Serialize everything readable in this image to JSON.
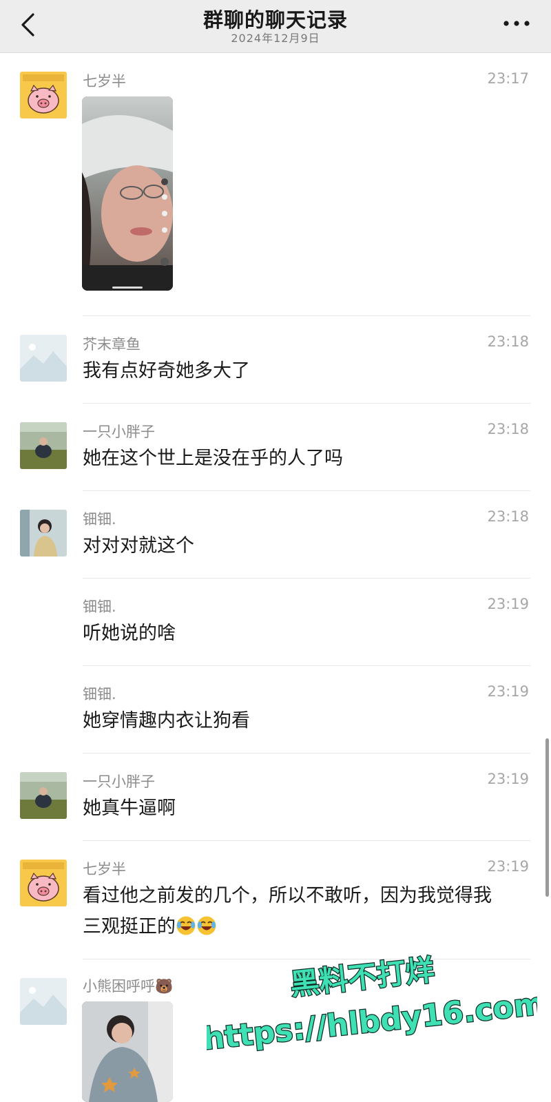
{
  "header": {
    "title": "群聊的聊天记录",
    "date": "2024年12月9日"
  },
  "messages": [
    {
      "sender": "七岁半",
      "time": "23:17",
      "avatar": "pig-avatar",
      "type": "image"
    },
    {
      "sender": "芥末章鱼",
      "time": "23:18",
      "avatar": "placeholder-avatar",
      "text": "我有点好奇她多大了"
    },
    {
      "sender": "一只小胖子",
      "time": "23:18",
      "avatar": "photo-avatar",
      "text": "她在这个世上是没在乎的人了吗"
    },
    {
      "sender": "钿钿.",
      "time": "23:18",
      "avatar": "girl-avatar",
      "text": "对对对就这个"
    },
    {
      "sender": "钿钿.",
      "time": "23:19",
      "text": "听她说的啥"
    },
    {
      "sender": "钿钿.",
      "time": "23:19",
      "text": "她穿情趣内衣让狗看"
    },
    {
      "sender": "一只小胖子",
      "time": "23:19",
      "avatar": "photo-avatar",
      "text": "她真牛逼啊"
    },
    {
      "sender": "七岁半",
      "time": "23:19",
      "avatar": "pig-avatar",
      "text_line1": "看过他之前发的几个，所以不敢听，因为我觉得我",
      "text_line2": "三观挺正的"
    },
    {
      "sender": "小熊困呼呼🐻",
      "avatar": "placeholder-avatar",
      "type": "image"
    }
  ],
  "watermark": {
    "line1": "黑料不打烊",
    "line2": "https://hlbdy16.com"
  },
  "colors": {
    "header_bg": "#ededed",
    "watermark_fill": "#3ee0b4"
  },
  "icons": {
    "back": "back-chevron-icon",
    "more": "more-dots-icon",
    "emoji": "rolling-laughing-emoji-icon"
  }
}
